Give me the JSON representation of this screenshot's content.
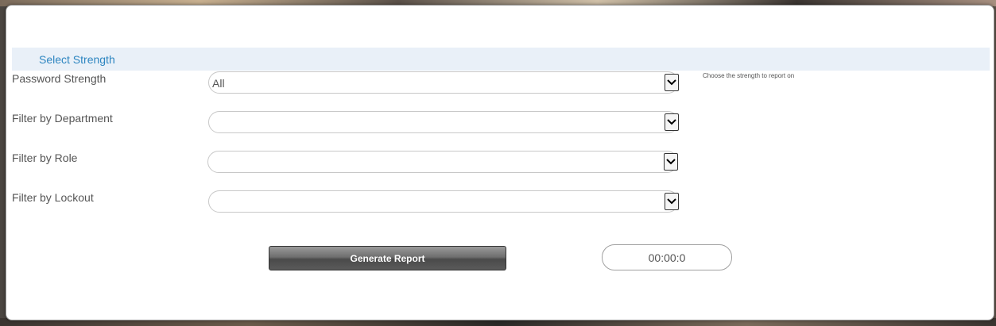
{
  "section": {
    "title": "Select Strength"
  },
  "fields": [
    {
      "label": "Password Strength",
      "value": "All"
    },
    {
      "label": "Filter by Department",
      "value": ""
    },
    {
      "label": "Filter by Role",
      "value": ""
    },
    {
      "label": "Filter by Lockout",
      "value": ""
    }
  ],
  "hint": "Choose the strength to report on",
  "actions": {
    "generate_label": "Generate Report"
  },
  "timer": {
    "value": "00:00:0"
  },
  "colors": {
    "accent": "#2e86c1",
    "header_bg": "#e9f0f8"
  }
}
